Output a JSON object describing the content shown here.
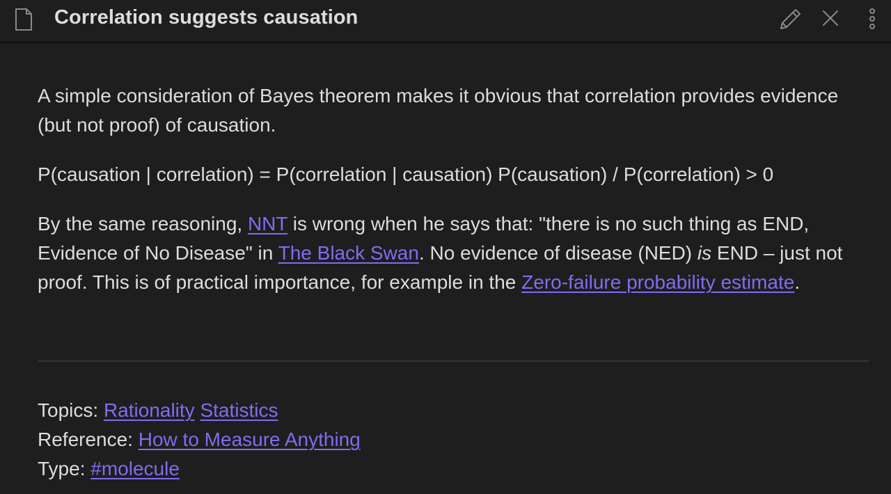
{
  "header": {
    "title": "Correlation suggests causation",
    "icons": {
      "document": "file-icon",
      "edit": "pencil-icon",
      "close": "close-icon",
      "more": "more-vertical-icon"
    }
  },
  "note": {
    "paragraph1": "A simple consideration of Bayes theorem makes it obvious that correlation provides evidence (but not proof) of causation.",
    "formula": "P(causation | correlation) = P(correlation | causation) P(causation) / P(correlation) > 0",
    "paragraph3": {
      "t1": "By the same reasoning, ",
      "link_nnt": "NNT",
      "t2": " is wrong when he says that: \"there is no such thing as END, Evidence of No Disease\" in ",
      "link_black_swan": "The Black Swan",
      "t3": ". No evidence of disease (NED) ",
      "emph": "is",
      "t4": " END – just not proof. This is of practical importance, for example in the ",
      "link_zero_failure": "Zero-failure probability estimate",
      "t5": "."
    }
  },
  "metadata": {
    "topics_label": "Topics: ",
    "topics": [
      "Rationality",
      "Statistics"
    ],
    "reference_label": "Reference: ",
    "reference": "How to Measure Anything",
    "type_label": "Type: ",
    "type": "#molecule"
  },
  "colors": {
    "background": "#1e1e1e",
    "text": "#dcddde",
    "link": "#7f6df2",
    "icon": "#8a8a8a",
    "divider": "#363636"
  }
}
